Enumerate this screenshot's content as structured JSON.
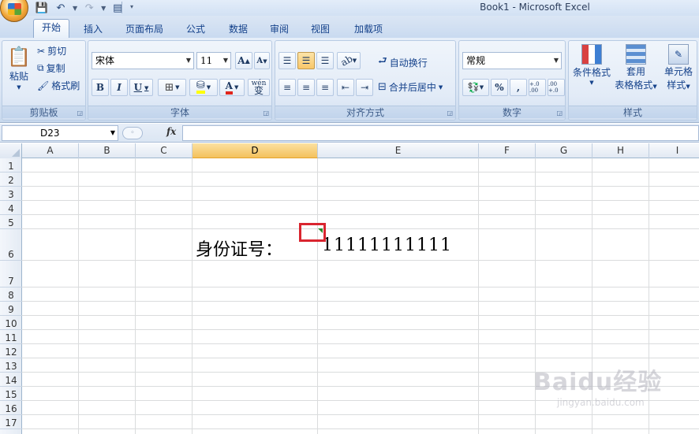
{
  "window": {
    "title": "Book1 - Microsoft Excel"
  },
  "tabs": [
    {
      "label": "开始",
      "active": true
    },
    {
      "label": "插入"
    },
    {
      "label": "页面布局"
    },
    {
      "label": "公式"
    },
    {
      "label": "数据"
    },
    {
      "label": "审阅"
    },
    {
      "label": "视图"
    },
    {
      "label": "加载项"
    }
  ],
  "ribbon": {
    "clipboard": {
      "label": "剪贴板",
      "paste": "粘贴",
      "cut": "剪切",
      "copy": "复制",
      "format_painter": "格式刷"
    },
    "font": {
      "label": "字体",
      "name": "宋体",
      "size": "11",
      "bold": "B",
      "italic": "I",
      "underline": "U",
      "phonetic": "wén",
      "phonetic_char": "变"
    },
    "alignment": {
      "label": "对齐方式",
      "wrap_text": "自动换行",
      "merge_center": "合并后居中"
    },
    "number": {
      "label": "数字",
      "format": "常规",
      "percent": "%",
      "comma": ",",
      "inc_decimal": "+.0 .00",
      "dec_decimal": ".00 +.0"
    },
    "styles": {
      "label": "样式",
      "conditional": "条件格式",
      "table_format_1": "套用",
      "table_format_2": "表格格式",
      "cell_styles_1": "单元格",
      "cell_styles_2": "样式"
    }
  },
  "formula_bar": {
    "name_box": "D23",
    "fx": "fx",
    "formula": ""
  },
  "columns": [
    "A",
    "B",
    "C",
    "D",
    "E",
    "F",
    "G",
    "H",
    "I"
  ],
  "selected_column": "D",
  "rows": [
    "1",
    "2",
    "3",
    "4",
    "5",
    "6",
    "7",
    "8",
    "9",
    "10",
    "11",
    "12",
    "13",
    "14",
    "15",
    "16",
    "17"
  ],
  "cells": {
    "D6": "身份证号：",
    "E6": "11111111111"
  },
  "watermark": {
    "brand": "Baidu经验",
    "url": "jingyan.baidu.com"
  },
  "colors": {
    "highlight": "#d9252f",
    "selected_header": "#f4c15d",
    "error_indicator": "#2a8a2a"
  }
}
